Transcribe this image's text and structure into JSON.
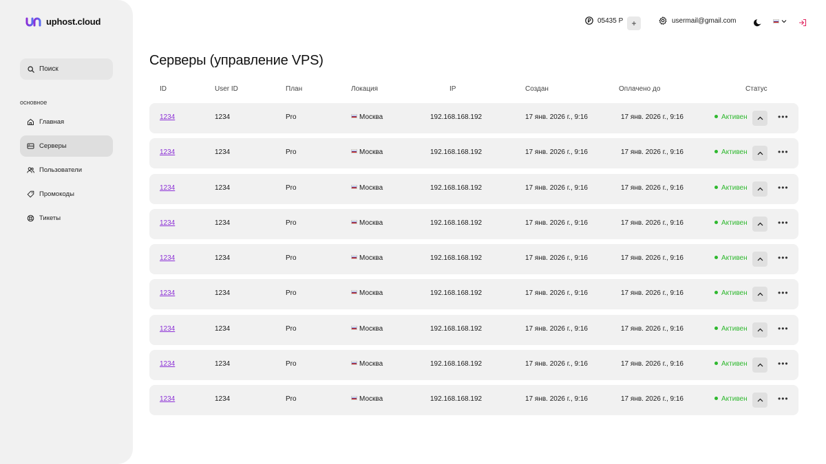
{
  "brand": {
    "name": "uphost.cloud",
    "accent": "#8b2fd6"
  },
  "sidebar": {
    "search_label": "Поиск",
    "section_label": "основное",
    "items": [
      {
        "label": "Главная",
        "icon": "home-icon",
        "active": false
      },
      {
        "label": "Серверы",
        "icon": "server-icon",
        "active": true
      },
      {
        "label": "Пользователи",
        "icon": "users-icon",
        "active": false
      },
      {
        "label": "Промокоды",
        "icon": "tag-icon",
        "active": false
      },
      {
        "label": "Тикеты",
        "icon": "support-icon",
        "active": false
      }
    ]
  },
  "topbar": {
    "balance": "05435 Р",
    "add_funds_label": "+",
    "email": "usermail@gmail.com",
    "language": "ru"
  },
  "page": {
    "title": "Серверы (управление VPS)"
  },
  "table": {
    "columns": [
      "ID",
      "User ID",
      "План",
      "Локация",
      "IP",
      "Создан",
      "Оплачено до",
      "Статус"
    ],
    "rows": [
      {
        "id": "1234",
        "user_id": "1234",
        "plan": "Pro",
        "location": "Москва",
        "ip": "192.168.168.192",
        "created": "17 янв. 2026 г., 9:16",
        "paid_until": "17 янв. 2026 г., 9:16",
        "status": "Активен"
      },
      {
        "id": "1234",
        "user_id": "1234",
        "plan": "Pro",
        "location": "Москва",
        "ip": "192.168.168.192",
        "created": "17 янв. 2026 г., 9:16",
        "paid_until": "17 янв. 2026 г., 9:16",
        "status": "Активен"
      },
      {
        "id": "1234",
        "user_id": "1234",
        "plan": "Pro",
        "location": "Москва",
        "ip": "192.168.168.192",
        "created": "17 янв. 2026 г., 9:16",
        "paid_until": "17 янв. 2026 г., 9:16",
        "status": "Активен"
      },
      {
        "id": "1234",
        "user_id": "1234",
        "plan": "Pro",
        "location": "Москва",
        "ip": "192.168.168.192",
        "created": "17 янв. 2026 г., 9:16",
        "paid_until": "17 янв. 2026 г., 9:16",
        "status": "Активен"
      },
      {
        "id": "1234",
        "user_id": "1234",
        "plan": "Pro",
        "location": "Москва",
        "ip": "192.168.168.192",
        "created": "17 янв. 2026 г., 9:16",
        "paid_until": "17 янв. 2026 г., 9:16",
        "status": "Активен"
      },
      {
        "id": "1234",
        "user_id": "1234",
        "plan": "Pro",
        "location": "Москва",
        "ip": "192.168.168.192",
        "created": "17 янв. 2026 г., 9:16",
        "paid_until": "17 янв. 2026 г., 9:16",
        "status": "Активен"
      },
      {
        "id": "1234",
        "user_id": "1234",
        "plan": "Pro",
        "location": "Москва",
        "ip": "192.168.168.192",
        "created": "17 янв. 2026 г., 9:16",
        "paid_until": "17 янв. 2026 г., 9:16",
        "status": "Активен"
      },
      {
        "id": "1234",
        "user_id": "1234",
        "plan": "Pro",
        "location": "Москва",
        "ip": "192.168.168.192",
        "created": "17 янв. 2026 г., 9:16",
        "paid_until": "17 янв. 2026 г., 9:16",
        "status": "Активен"
      },
      {
        "id": "1234",
        "user_id": "1234",
        "plan": "Pro",
        "location": "Москва",
        "ip": "192.168.168.192",
        "created": "17 янв. 2026 г., 9:16",
        "paid_until": "17 янв. 2026 г., 9:16",
        "status": "Активен"
      }
    ]
  },
  "colors": {
    "status_active": "#2eb82e",
    "row_bg": "#f1f1f1",
    "sidebar_bg": "#f1f1f1"
  }
}
